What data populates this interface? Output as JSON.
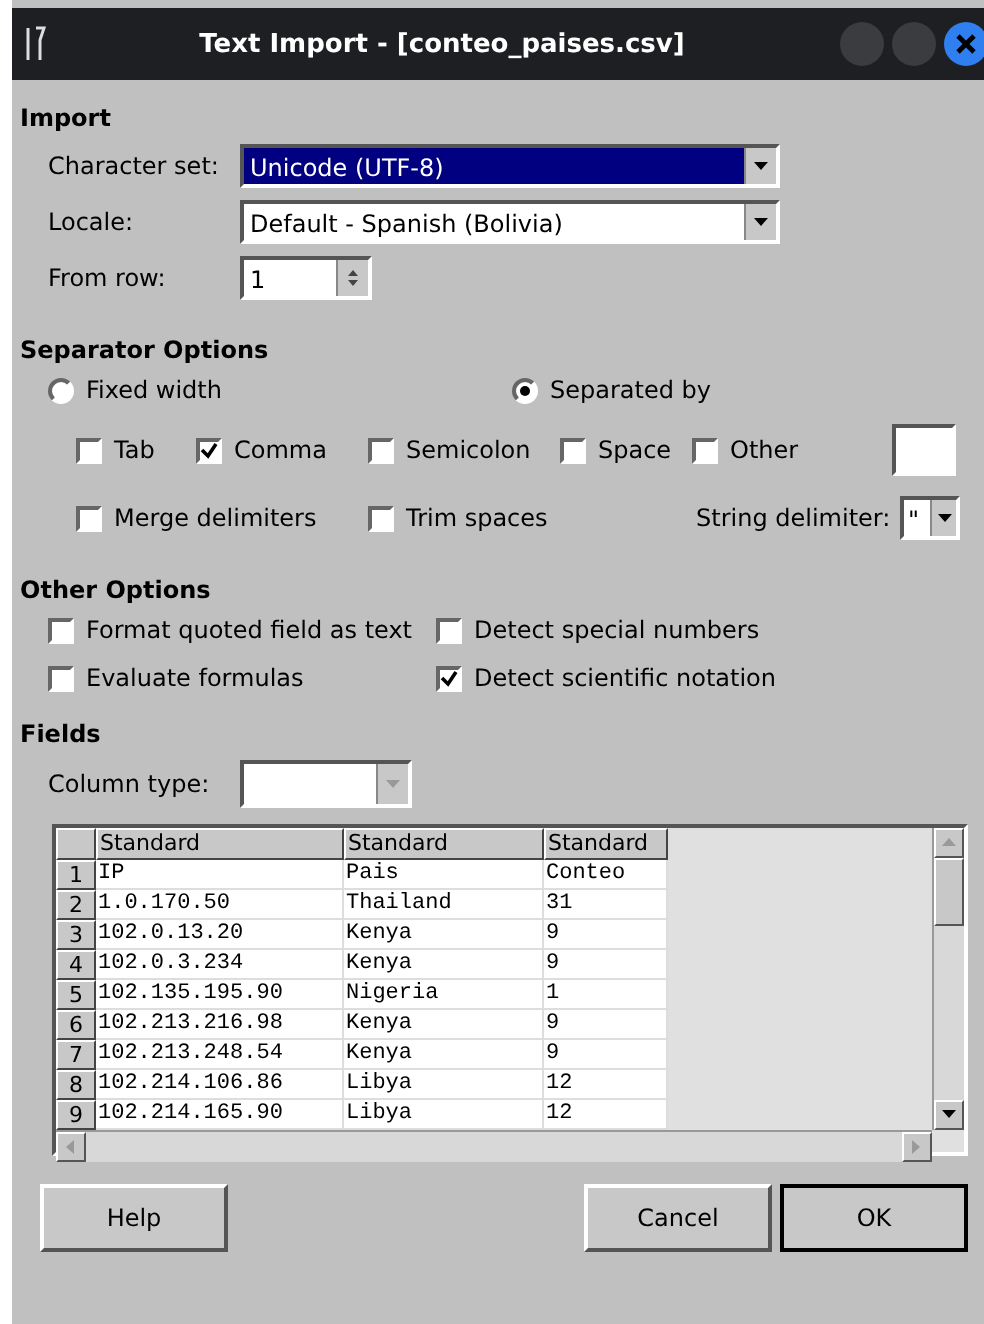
{
  "window": {
    "title": "Text Import - [conteo_paises.csv]"
  },
  "import": {
    "heading": "Import",
    "character_set": {
      "label": "Character set:",
      "value": "Unicode (UTF-8)",
      "selected": true
    },
    "locale": {
      "label": "Locale:",
      "value": "Default - Spanish (Bolivia)",
      "selected": false
    },
    "from_row": {
      "label": "From row:",
      "value": "1"
    }
  },
  "separator_options": {
    "heading": "Separator Options",
    "modes": [
      {
        "label": "Fixed width",
        "selected": false
      },
      {
        "label": "Separated by",
        "selected": true
      }
    ],
    "separators": [
      {
        "label": "Tab",
        "checked": false
      },
      {
        "label": "Comma",
        "checked": true
      },
      {
        "label": "Semicolon",
        "checked": false
      },
      {
        "label": "Space",
        "checked": false
      },
      {
        "label": "Other",
        "checked": false
      }
    ],
    "extras": [
      {
        "label": "Merge delimiters",
        "checked": false
      },
      {
        "label": "Trim spaces",
        "checked": false
      }
    ],
    "string_delimiter": {
      "label": "String delimiter:",
      "value": "\""
    }
  },
  "other_options": {
    "heading": "Other Options",
    "options": [
      {
        "label": "Format quoted field as text",
        "checked": false
      },
      {
        "label": "Detect special numbers",
        "checked": false
      },
      {
        "label": "Evaluate formulas",
        "checked": false
      },
      {
        "label": "Detect scientific notation",
        "checked": true
      }
    ]
  },
  "fields": {
    "heading": "Fields",
    "column_type": {
      "label": "Column type:"
    },
    "table": {
      "columns": [
        "Standard",
        "Standard",
        "Standard"
      ],
      "rows": [
        {
          "number": "1",
          "cells": [
            "IP",
            "Pais",
            "Conteo"
          ]
        },
        {
          "number": "2",
          "cells": [
            "1.0.170.50",
            "Thailand",
            "31"
          ]
        },
        {
          "number": "3",
          "cells": [
            "102.0.13.20",
            "Kenya",
            "9"
          ]
        },
        {
          "number": "4",
          "cells": [
            "102.0.3.234",
            "Kenya",
            "9"
          ]
        },
        {
          "number": "5",
          "cells": [
            "102.135.195.90",
            "Nigeria",
            "1"
          ]
        },
        {
          "number": "6",
          "cells": [
            "102.213.216.98",
            "Kenya",
            "9"
          ]
        },
        {
          "number": "7",
          "cells": [
            "102.213.248.54",
            "Kenya",
            "9"
          ]
        },
        {
          "number": "8",
          "cells": [
            "102.214.106.86",
            "Libya",
            "12"
          ]
        },
        {
          "number": "9",
          "cells": [
            "102.214.165.90",
            "Libya",
            "12"
          ]
        }
      ]
    }
  },
  "buttons": [
    {
      "label": "Help",
      "kind": "plain"
    },
    {
      "label": "Cancel",
      "kind": "plain"
    },
    {
      "label": "OK",
      "kind": "default"
    }
  ]
}
